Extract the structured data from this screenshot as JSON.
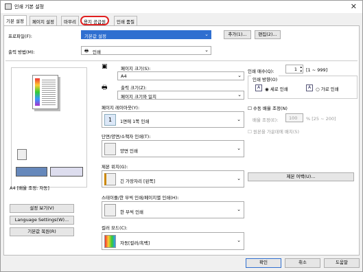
{
  "window": {
    "title": "인쇄 기본 설정"
  },
  "tabs": [
    {
      "label": "기본 설정"
    },
    {
      "label": "페이지 설정"
    },
    {
      "label": "마무리"
    },
    {
      "label": "용지 공급원"
    },
    {
      "label": "인쇄 품질"
    }
  ],
  "profile": {
    "label": "프로파일(F):",
    "value": "기본값 설정",
    "add": "추가(1)...",
    "edit": "편집(2)..."
  },
  "output": {
    "label": "출력 방법(M):",
    "value": "인쇄"
  },
  "preview": {
    "caption": "A4 [배율 조정: 자동]"
  },
  "left_buttons": {
    "view_settings": "설정 보기(V)",
    "language": "Language Settings(W)...",
    "restore": "기본값 복원(R)"
  },
  "page_size": {
    "label": "페이지 크기(S):",
    "value": "A4"
  },
  "output_size": {
    "label": "출력 크기(Z):",
    "value": "페이지 크기와 일치"
  },
  "layout": {
    "label": "페이지 레이아웃(Y):",
    "value": "1면에 1쪽 인쇄",
    "num": "1"
  },
  "duplex": {
    "label": "단면/양면/소책자 인쇄(T):",
    "value": "양면 인쇄"
  },
  "binding": {
    "label": "제본 위치(G):",
    "value": "긴 가장자리 [왼쪽]",
    "margin_btn": "제본 여백(U)..."
  },
  "staple": {
    "label": "스테이플/한 부씩 인쇄/페이지별 인쇄(H):",
    "value": "한 부씩 인쇄"
  },
  "color": {
    "label": "컬러 모드(C):",
    "value": "자동[컬러/흑백]"
  },
  "copies": {
    "label": "인쇄 매수(Q):",
    "value": "1",
    "range": "[1 ~ 999]"
  },
  "orientation": {
    "label": "인쇄 방향(O)",
    "portrait": "세로 인쇄",
    "landscape": "가로 인쇄"
  },
  "manual_scale": {
    "label": "수동 배율 조정(N)"
  },
  "scale": {
    "label": "배율 조정(E):",
    "value": "100",
    "range": "% [25 ~ 200]"
  },
  "border": {
    "label": "원본을 가운데에 배치(5)"
  },
  "footer": {
    "ok": "확인",
    "cancel": "취소",
    "help": "도움말"
  }
}
